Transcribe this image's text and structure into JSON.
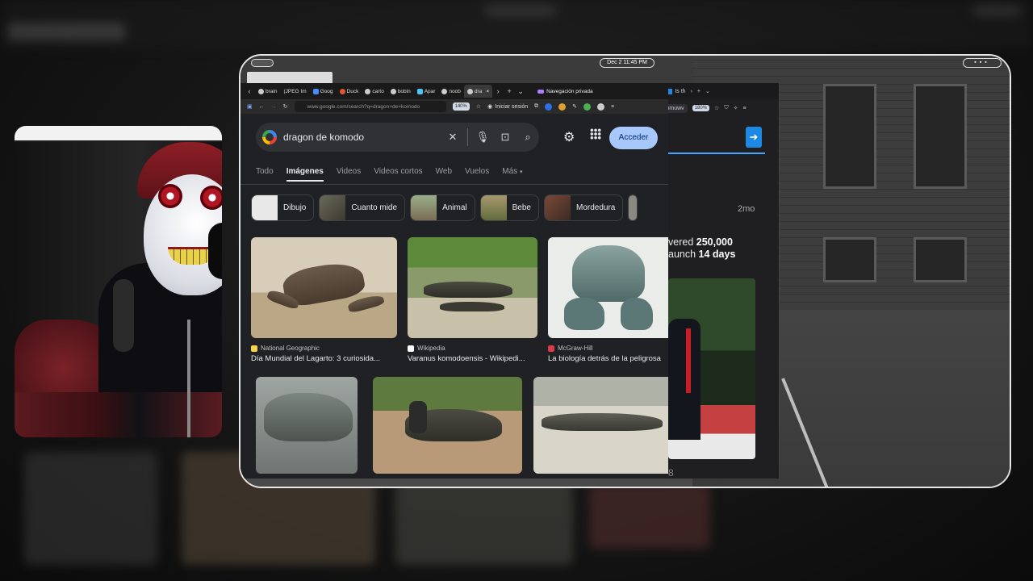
{
  "desktop": {
    "clock": "Dec 2  11:45 PM"
  },
  "main_browser": {
    "tabs": [
      {
        "label": "brain"
      },
      {
        "label": "(JPEG Im"
      },
      {
        "label": "Goog"
      },
      {
        "label": "Duck"
      },
      {
        "label": "carto"
      },
      {
        "label": "bobin"
      },
      {
        "label": "Apar"
      },
      {
        "label": "noob"
      },
      {
        "label": "dra"
      }
    ],
    "private_label": "Navegación privada",
    "url": "www.google.com/search?q=dragon+de+komodo",
    "zoom": "140%",
    "signin_label": "Iniciar sesión"
  },
  "google": {
    "query": "dragon de komodo",
    "acceder_label": "Acceder",
    "tabs": [
      "Todo",
      "Imágenes",
      "Videos",
      "Videos cortos",
      "Web",
      "Vuelos",
      "Más"
    ],
    "active_tab": "Imágenes",
    "chips": [
      "Dibujo",
      "Cuanto mide",
      "Animal",
      "Bebe",
      "Mordedura"
    ],
    "results": [
      {
        "source": "National Geographic",
        "title": "Día Mundial del Lagarto: 3 curiosida...",
        "fav_color": "#f5d547"
      },
      {
        "source": "Wikipedia",
        "title": "Varanus komodoensis - Wikipedi...",
        "fav_color": "#ffffff"
      },
      {
        "source": "McGraw-Hill",
        "title": "La biología detrás de la peligrosa",
        "fav_color": "#d93b4a"
      }
    ]
  },
  "second_browser": {
    "tab_label": "Is th",
    "url": "sbmuwv",
    "zoom": "180%",
    "time_ago": "2mo",
    "text_line1_prefix": "vered ",
    "text_line1_bold": "250,000",
    "text_line2_prefix": "aunch ",
    "text_line2_bold": "14 days",
    "count": "8"
  }
}
